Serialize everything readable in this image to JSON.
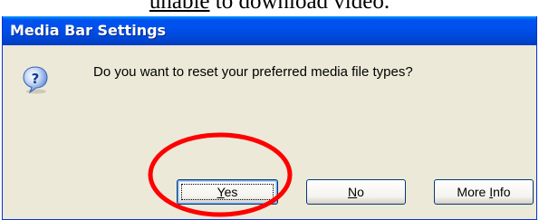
{
  "doc": {
    "text_underlined": "unable",
    "text_rest": " to download video."
  },
  "dialog": {
    "title": "Media Bar Settings",
    "icon": "question-icon",
    "message": "Do you want to reset your preferred media file types?",
    "buttons": {
      "yes": {
        "accel": "Y",
        "rest": "es"
      },
      "no": {
        "accel": "N",
        "rest": "o"
      },
      "more_info": {
        "pre": "More ",
        "accel": "I",
        "rest": "nfo"
      }
    }
  },
  "colors": {
    "titlebar": "#0050ee",
    "dialog_bg": "#ece9d8",
    "annotation": "#ff0000"
  }
}
